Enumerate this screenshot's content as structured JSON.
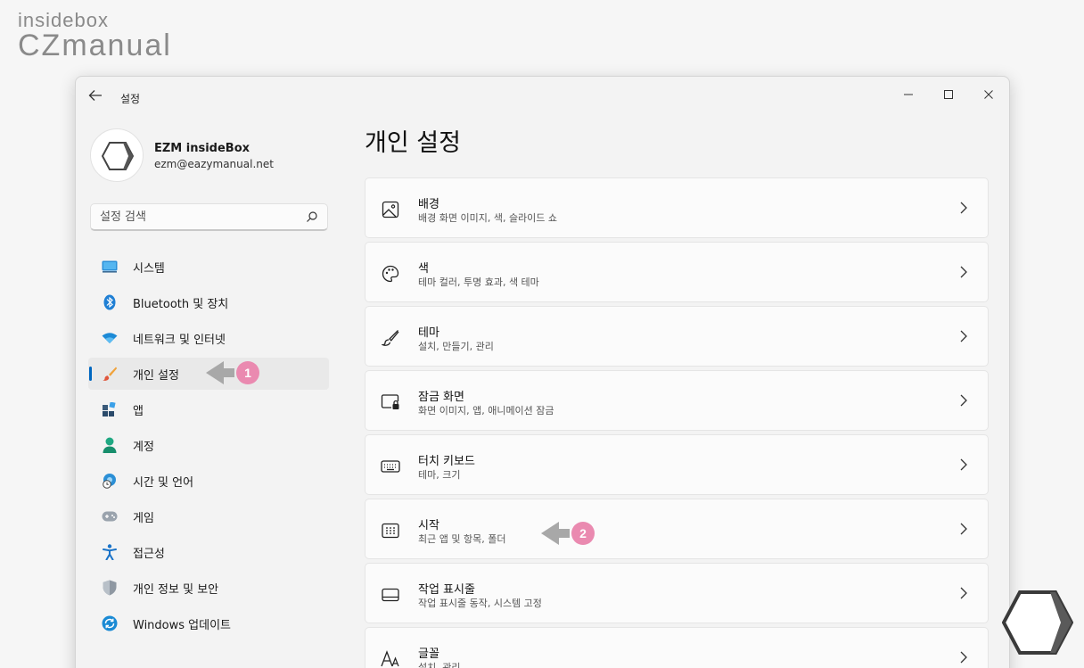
{
  "watermark": {
    "line1": "insidebox",
    "line2": "CZmanual"
  },
  "window": {
    "title": "설정"
  },
  "profile": {
    "name": "EZM insideBox",
    "email": "ezm@eazymanual.net"
  },
  "search": {
    "placeholder": "설정 검색"
  },
  "sidebar": {
    "items": [
      {
        "label": "시스템",
        "icon": "monitor-icon"
      },
      {
        "label": "Bluetooth 및 장치",
        "icon": "bluetooth-icon"
      },
      {
        "label": "네트워크 및 인터넷",
        "icon": "wifi-icon"
      },
      {
        "label": "개인 설정",
        "icon": "brush-icon",
        "active": true
      },
      {
        "label": "앱",
        "icon": "apps-icon"
      },
      {
        "label": "계정",
        "icon": "person-icon"
      },
      {
        "label": "시간 및 언어",
        "icon": "globe-clock-icon"
      },
      {
        "label": "게임",
        "icon": "gamepad-icon"
      },
      {
        "label": "접근성",
        "icon": "accessibility-icon"
      },
      {
        "label": "개인 정보 및 보안",
        "icon": "shield-icon"
      },
      {
        "label": "Windows 업데이트",
        "icon": "update-icon"
      }
    ]
  },
  "main": {
    "title": "개인 설정",
    "cards": [
      {
        "title": "배경",
        "subtitle": "배경 화면 이미지, 색, 슬라이드 쇼",
        "icon": "image-icon"
      },
      {
        "title": "색",
        "subtitle": "테마 컬러, 투명 효과, 색 테마",
        "icon": "palette-icon"
      },
      {
        "title": "테마",
        "subtitle": "설치, 만들기, 관리",
        "icon": "brush-icon"
      },
      {
        "title": "잠금 화면",
        "subtitle": "화면 이미지, 앱, 애니메이션 잠금",
        "icon": "lock-screen-icon"
      },
      {
        "title": "터치 키보드",
        "subtitle": "테마, 크기",
        "icon": "keyboard-icon"
      },
      {
        "title": "시작",
        "subtitle": "최근 앱 및 항목, 폴더",
        "icon": "start-icon"
      },
      {
        "title": "작업 표시줄",
        "subtitle": "작업 표시줄 동작, 시스템 고정",
        "icon": "taskbar-icon"
      },
      {
        "title": "글꼴",
        "subtitle": "설치, 관리",
        "icon": "font-icon"
      }
    ]
  },
  "annotations": {
    "step1": "1",
    "step2": "2"
  },
  "colors": {
    "accent": "#0067c0",
    "badge": "#ea8ab0",
    "arrow": "#a8a8a8"
  }
}
